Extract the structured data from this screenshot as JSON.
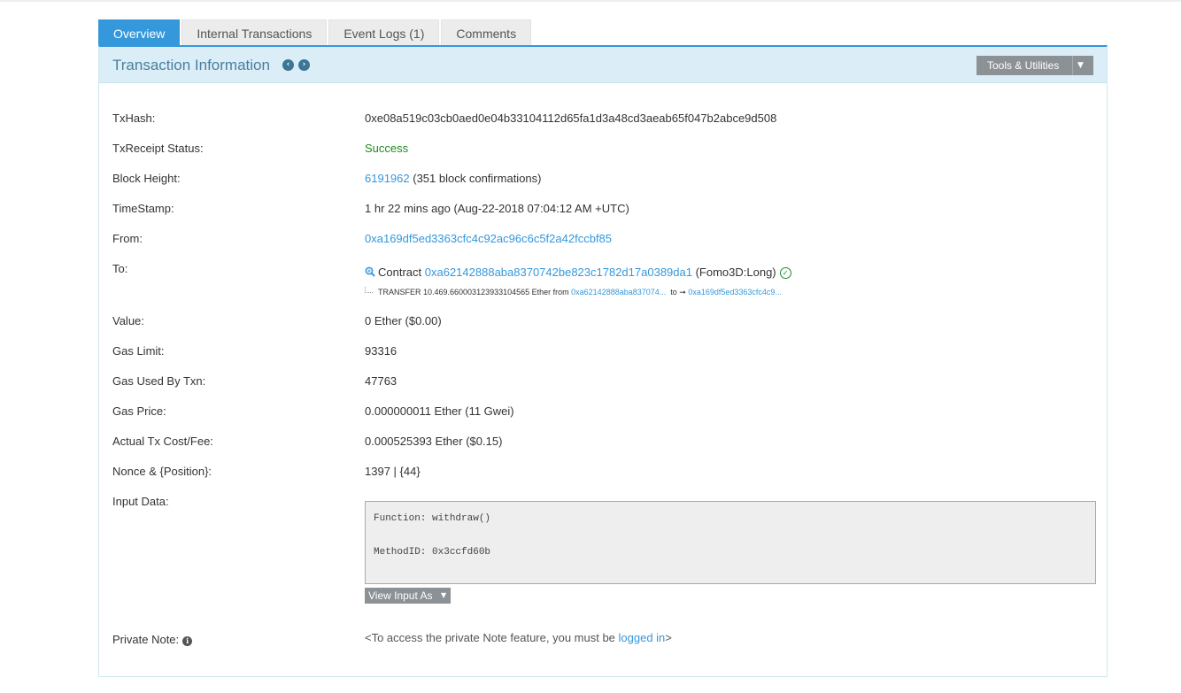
{
  "tabs": [
    {
      "label": "Overview"
    },
    {
      "label": "Internal Transactions"
    },
    {
      "label": "Event Logs (1)"
    },
    {
      "label": "Comments"
    }
  ],
  "panel": {
    "title": "Transaction Information",
    "tools_label": "Tools & Utilities"
  },
  "fields": {
    "txhash": {
      "label": "TxHash:",
      "value": "0xe08a519c03cb0aed0e04b33104112d65fa1d3a48cd3aeab65f047b2abce9d508"
    },
    "status": {
      "label": "TxReceipt Status:",
      "value": "Success"
    },
    "block": {
      "label": "Block Height:",
      "value": "6191962",
      "extra": "(351 block confirmations)"
    },
    "timestamp": {
      "label": "TimeStamp:",
      "value": "1 hr 22 mins ago (Aug-22-2018 07:04:12 AM +UTC)"
    },
    "from": {
      "label": "From:",
      "value": "0xa169df5ed3363cfc4c92ac96c6c5f2a42fccbf85"
    },
    "to": {
      "label": "To:",
      "prefix": "Contract",
      "address": "0xa62142888aba8370742be823c1782d17a0389da1",
      "name": "(Fomo3D:Long)"
    },
    "transfer": {
      "text": "TRANSFER  10.469.660003123933104565 Ether from",
      "from": "0xa62142888aba837074...",
      "to_label": "to ➞",
      "to": "0xa169df5ed3363cfc4c9..."
    },
    "value": {
      "label": "Value:",
      "value": "0 Ether ($0.00)"
    },
    "gas_limit": {
      "label": "Gas Limit:",
      "value": "93316"
    },
    "gas_used": {
      "label": "Gas Used By Txn:",
      "value": "47763"
    },
    "gas_price": {
      "label": "Gas Price:",
      "value": "0.000000011 Ether (11 Gwei)"
    },
    "fee": {
      "label": "Actual Tx Cost/Fee:",
      "value": "0.000525393 Ether ($0.15)"
    },
    "nonce": {
      "label": "Nonce & {Position}:",
      "value": "1397 | {44}"
    },
    "input": {
      "label": "Input Data:",
      "function": "Function: withdraw()",
      "method": "MethodID: 0x3ccfd60b",
      "view_as": "View Input As"
    },
    "note": {
      "label": "Private Note:",
      "prefix": "<To access the private Note feature, you must be ",
      "link": "logged in",
      "suffix": ">"
    }
  },
  "colors": {
    "accent": "#3498db",
    "success": "#1e8a1e",
    "header_bg": "#dbeef8"
  },
  "icons": [
    "arrow-left-icon",
    "arrow-right-icon",
    "caret-down-icon",
    "search-icon",
    "check-circle-icon",
    "info-icon"
  ]
}
